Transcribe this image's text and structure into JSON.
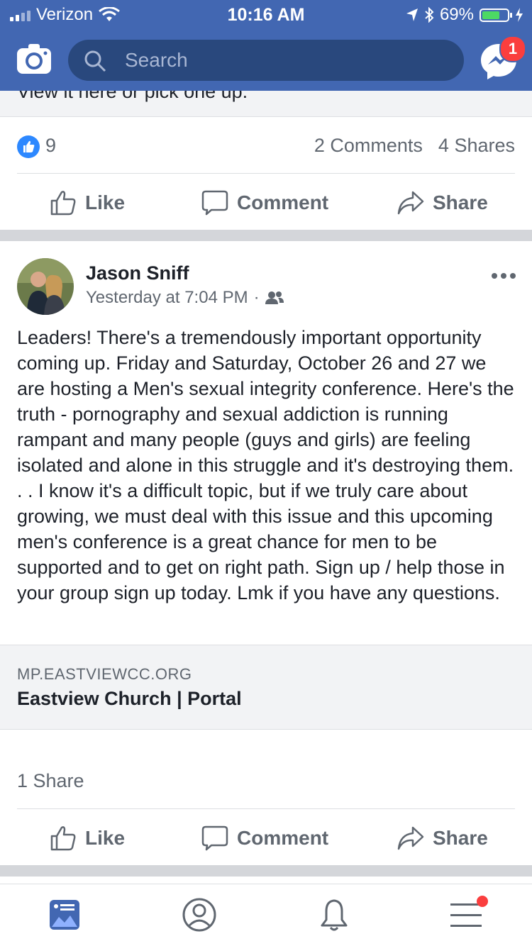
{
  "status_bar": {
    "carrier": "Verizon",
    "time": "10:16 AM",
    "battery": "69%",
    "battery_color": "#4cd964"
  },
  "header": {
    "search_placeholder": "Search",
    "messenger_badge": "1",
    "brand_color": "#4267b2"
  },
  "previous_post": {
    "link_text_cut": "View it here or pick one up.",
    "like_count": "9",
    "comments": "2 Comments",
    "shares": "4 Shares"
  },
  "actions": {
    "like": "Like",
    "comment": "Comment",
    "share": "Share"
  },
  "post": {
    "author": "Jason Sniff",
    "timestamp": "Yesterday at 7:04 PM",
    "audience_icon": "group-icon",
    "text": "Leaders! There's a tremendously important opportunity coming up. Friday and Saturday, October 26 and 27 we are hosting a Men's sexual integrity conference. Here's the truth - pornography and sexual addiction is running rampant and many people (guys and girls) are feeling isolated and alone in this struggle and it's destroying them. . . I know it's a difficult topic, but if we truly care about growing, we must deal with this issue and this upcoming men's conference is a great chance for men to be supported and to get on right path. Sign up / help those in your group sign up today. Lmk if you have any questions.",
    "link_domain": "MP.EASTVIEWCC.ORG",
    "link_title": "Eastview Church | Portal",
    "share_count": "1 Share"
  },
  "tabs": [
    "news-feed-icon",
    "profile-icon",
    "notifications-icon",
    "menu-icon"
  ]
}
